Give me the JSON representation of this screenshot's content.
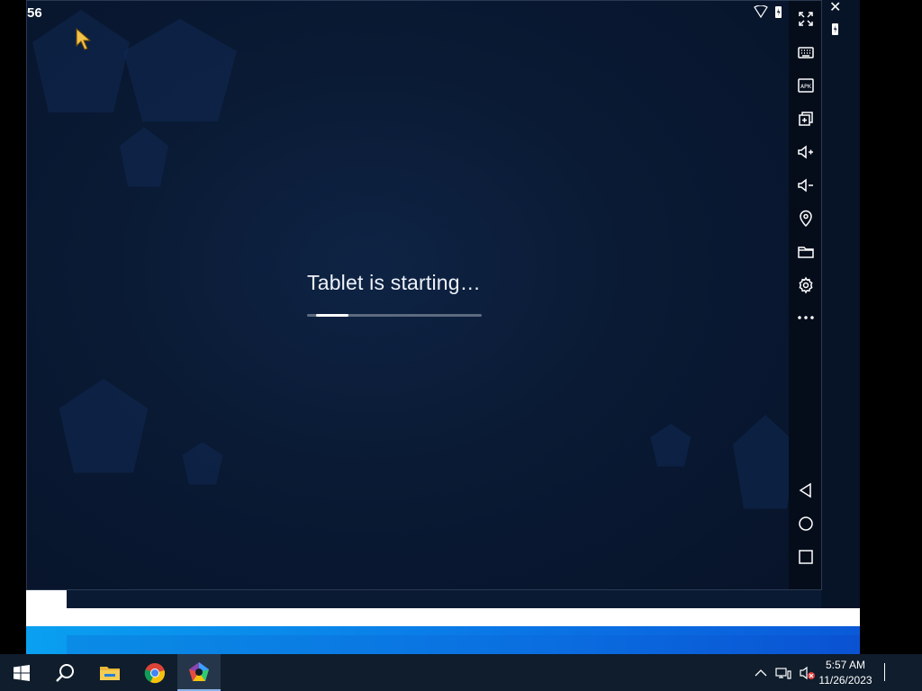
{
  "emulator": {
    "fps_counter": "56",
    "boot_title": "Tablet is starting…",
    "boot_progress": 0.3,
    "colors": {
      "screen_bg": "#0a1a34",
      "progress_track": "#5d6b80",
      "progress_fill": "#ffffff"
    }
  },
  "toolbar": {
    "items": [
      {
        "name": "fullscreen-icon",
        "label": "Full screen"
      },
      {
        "name": "keyboard-icon",
        "label": "Keyboard"
      },
      {
        "name": "apk-icon",
        "label": "APK"
      },
      {
        "name": "multi-instance-icon",
        "label": "Multi-instance"
      },
      {
        "name": "volume-up-icon",
        "label": "Volume up"
      },
      {
        "name": "volume-down-icon",
        "label": "Volume down"
      },
      {
        "name": "location-icon",
        "label": "Location"
      },
      {
        "name": "folder-icon",
        "label": "Folder"
      },
      {
        "name": "settings-gear-icon",
        "label": "Settings"
      },
      {
        "name": "more-icon",
        "label": "More"
      }
    ],
    "apk_text": "APK",
    "nav": [
      {
        "name": "back-icon"
      },
      {
        "name": "home-icon"
      },
      {
        "name": "recents-icon"
      }
    ]
  },
  "taskbar": {
    "apps": [
      {
        "name": "start-icon"
      },
      {
        "name": "search-icon"
      },
      {
        "name": "file-explorer-icon"
      },
      {
        "name": "chrome-icon"
      },
      {
        "name": "emulator-app-icon"
      }
    ],
    "time": "5:57 AM",
    "date": "11/26/2023"
  }
}
